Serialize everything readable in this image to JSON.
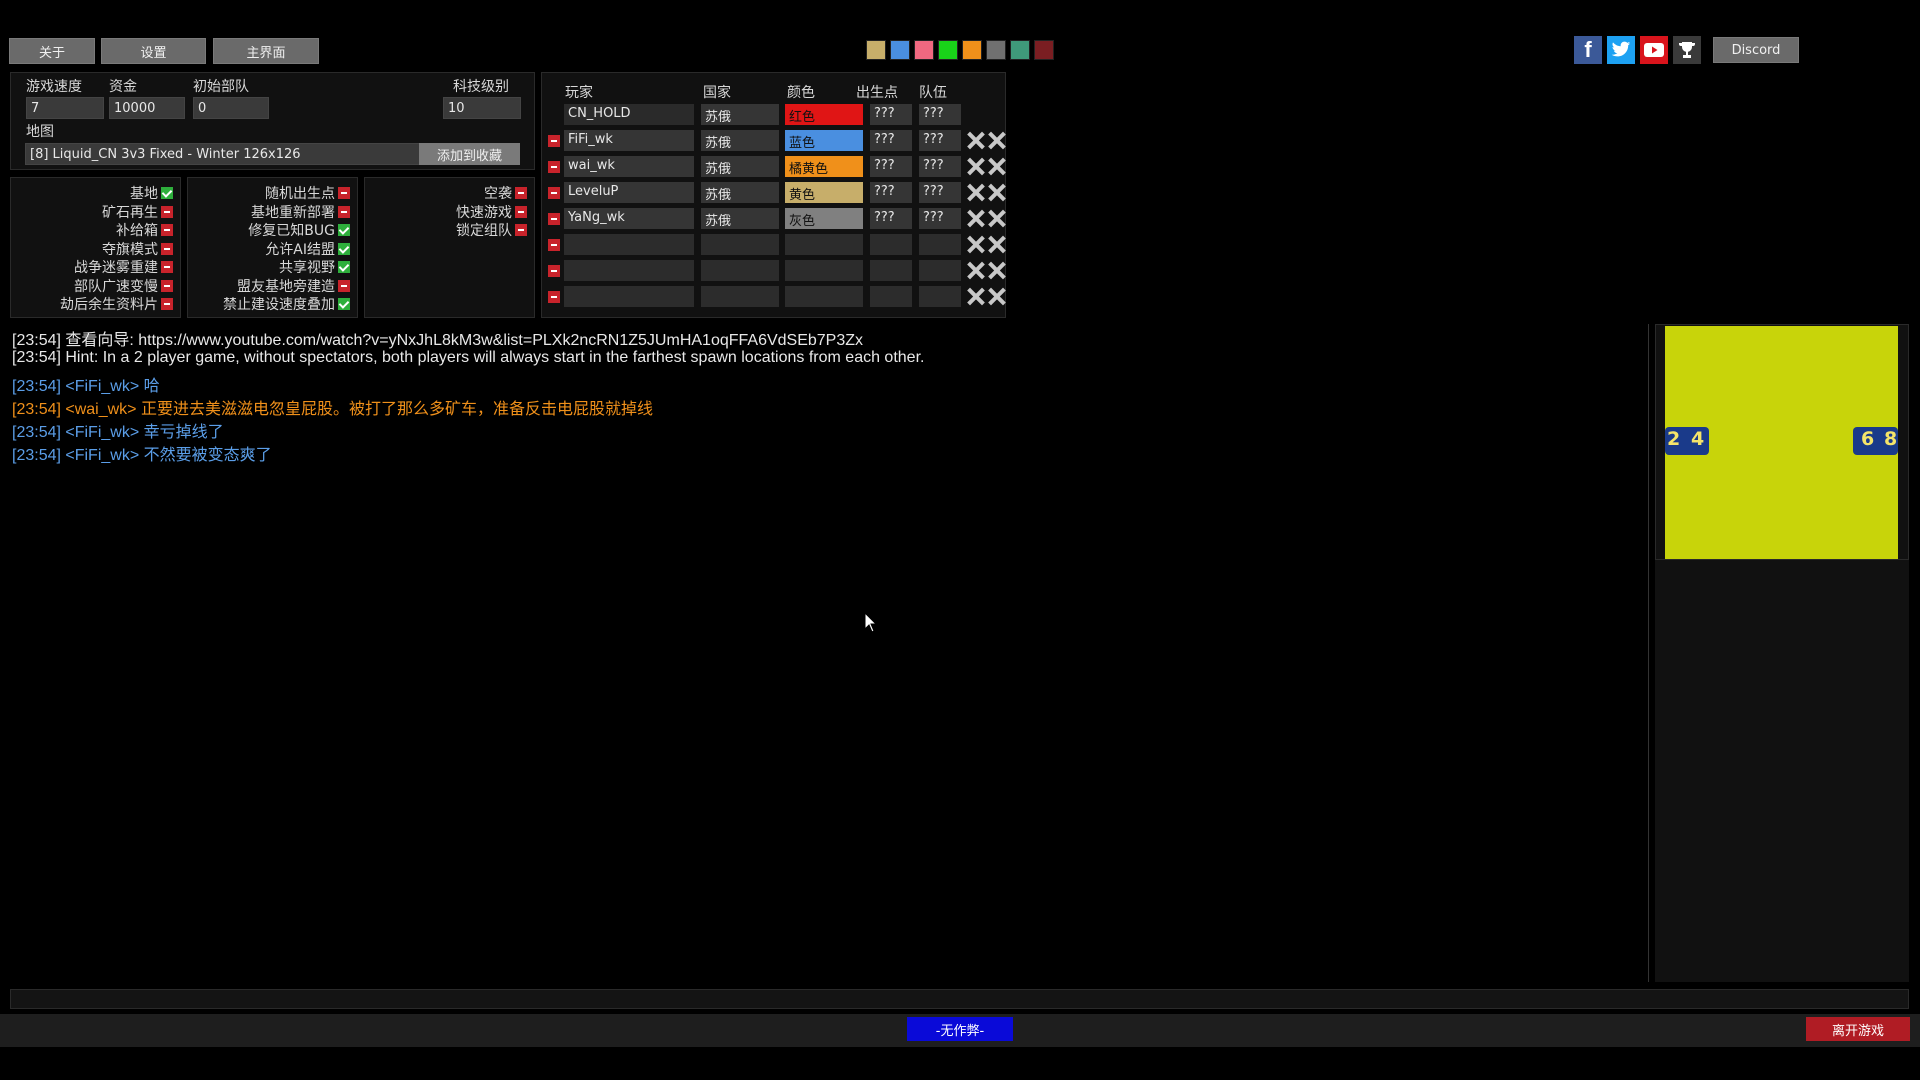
{
  "top_buttons": {
    "about": "关于",
    "settings": "设置",
    "main_menu": "主界面"
  },
  "color_swatches": [
    "#c7ae6a",
    "#4a8fe0",
    "#f06880",
    "#19d219",
    "#f0901a",
    "#707070",
    "#3f9a7a",
    "#7a1e22"
  ],
  "social": {
    "facebook": "facebook-icon",
    "twitter": "twitter-icon",
    "youtube": "youtube-icon",
    "trophy": "trophy-icon",
    "discord_label": "Discord"
  },
  "settings": {
    "game_speed_label": "游戏速度",
    "game_speed": "7",
    "funds_label": "资金",
    "funds": "10000",
    "start_units_label": "初始部队",
    "start_units": "0",
    "tech_label": "科技级别",
    "tech": "10",
    "map_label": "地图",
    "map": "[8] Liquid_CN 3v3 Fixed - Winter 126x126",
    "add_favorite": "添加到收藏"
  },
  "options_col1": [
    {
      "label": "基地",
      "on": true
    },
    {
      "label": "矿石再生",
      "on": false
    },
    {
      "label": "补给箱",
      "on": false
    },
    {
      "label": "夺旗模式",
      "on": false
    },
    {
      "label": "战争迷雾重建",
      "on": false
    },
    {
      "label": "部队广速变慢",
      "on": false
    },
    {
      "label": "劫后余生资料片",
      "on": false
    }
  ],
  "options_col2": [
    {
      "label": "随机出生点",
      "on": false
    },
    {
      "label": "基地重新部署",
      "on": false
    },
    {
      "label": "修复已知BUG",
      "on": true
    },
    {
      "label": "允许AI结盟",
      "on": true
    },
    {
      "label": "共享视野",
      "on": true
    },
    {
      "label": "盟友基地旁建造",
      "on": false
    },
    {
      "label": "禁止建设速度叠加",
      "on": true
    }
  ],
  "options_col3": [
    {
      "label": "空袭",
      "on": false
    },
    {
      "label": "快速游戏",
      "on": false
    },
    {
      "label": "锁定组队",
      "on": false
    }
  ],
  "players_header": {
    "player": "玩家",
    "country": "国家",
    "color": "颜色",
    "spawn": "出生点",
    "team": "队伍"
  },
  "players": [
    {
      "name": "CN_HOLD",
      "country": "苏俄",
      "color": "红色",
      "color_hex": "#e01515",
      "spawn": "???",
      "team": "???"
    },
    {
      "name": "FiFi_wk",
      "country": "苏俄",
      "color": "蓝色",
      "color_hex": "#4a8fe0",
      "spawn": "???",
      "team": "???"
    },
    {
      "name": "wai_wk",
      "country": "苏俄",
      "color": "橘黄色",
      "color_hex": "#f0901a",
      "spawn": "???",
      "team": "???"
    },
    {
      "name": "LeveluP",
      "country": "苏俄",
      "color": "黄色",
      "color_hex": "#c7ae6a",
      "spawn": "???",
      "team": "???"
    },
    {
      "name": "YaNg_wk",
      "country": "苏俄",
      "color": "灰色",
      "color_hex": "#808080",
      "spawn": "???",
      "team": "???"
    }
  ],
  "chat": [
    {
      "text": "[23:54] 查看向导: https://www.youtube.com/watch?v=yNxJhL8kM3w&list=PLXk2ncRN1Z5JUmHA1oqFFA6VdSEb7P3Zx",
      "color": "#e8e8e8"
    },
    {
      "text": "[23:54] Hint: In a 2 player game, without spectators, both players will always start in the farthest spawn locations from each other.",
      "color": "#e8e8e8"
    },
    {
      "text": "[23:54]  <FiFi_wk> 哈",
      "color": "#5b9ee8"
    },
    {
      "text": "[23:54]  <wai_wk> 正要进去美滋滋电忽皇屁股。被打了那么多矿车，准备反击电屁股就掉线",
      "color": "#f0901a"
    },
    {
      "text": "[23:54]  <FiFi_wk> 幸亏掉线了",
      "color": "#5b9ee8"
    },
    {
      "text": "[23:54]  <FiFi_wk> 不然要被变态爽了",
      "color": "#5b9ee8"
    }
  ],
  "minimap": {
    "map_color": "#c8d40a",
    "spawns": [
      "2",
      "4",
      "6",
      "8"
    ]
  },
  "bottom": {
    "no_cheat": "-无作弊-",
    "leave_game": "离开游戏"
  }
}
